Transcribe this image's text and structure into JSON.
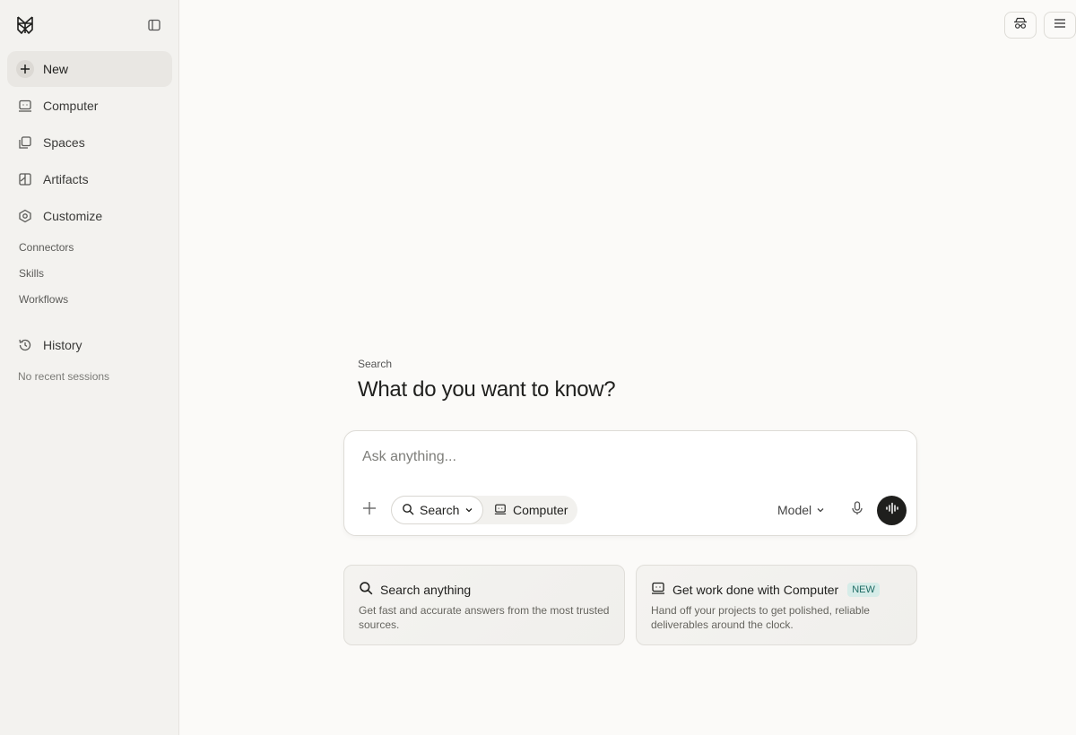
{
  "sidebar": {
    "nav": [
      {
        "label": "New",
        "icon": "plus-icon"
      },
      {
        "label": "Computer",
        "icon": "computer-icon"
      },
      {
        "label": "Spaces",
        "icon": "spaces-icon"
      },
      {
        "label": "Artifacts",
        "icon": "artifacts-icon"
      },
      {
        "label": "Customize",
        "icon": "customize-icon"
      }
    ],
    "sub_items": [
      "Connectors",
      "Skills",
      "Workflows"
    ],
    "history_label": "History",
    "no_recent": "No recent sessions"
  },
  "main": {
    "label": "Search",
    "title": "What do you want to know?",
    "composer": {
      "placeholder": "Ask anything...",
      "value": "",
      "mode_search": "Search",
      "mode_computer": "Computer",
      "model_label": "Model"
    },
    "cards": [
      {
        "title": "Search anything",
        "desc": "Get fast and accurate answers from the most trusted sources.",
        "icon": "search-icon"
      },
      {
        "title": "Get work done with Computer",
        "badge": "NEW",
        "desc": "Hand off your projects to get polished, reliable deliverables around the clock.",
        "icon": "computer-icon"
      }
    ]
  },
  "colors": {
    "background": "#fbfaf8",
    "sidebar": "#f3f2ef",
    "accent_dark": "#1f1f1d",
    "badge_bg": "#d6ece8",
    "badge_text": "#1f6b64"
  }
}
